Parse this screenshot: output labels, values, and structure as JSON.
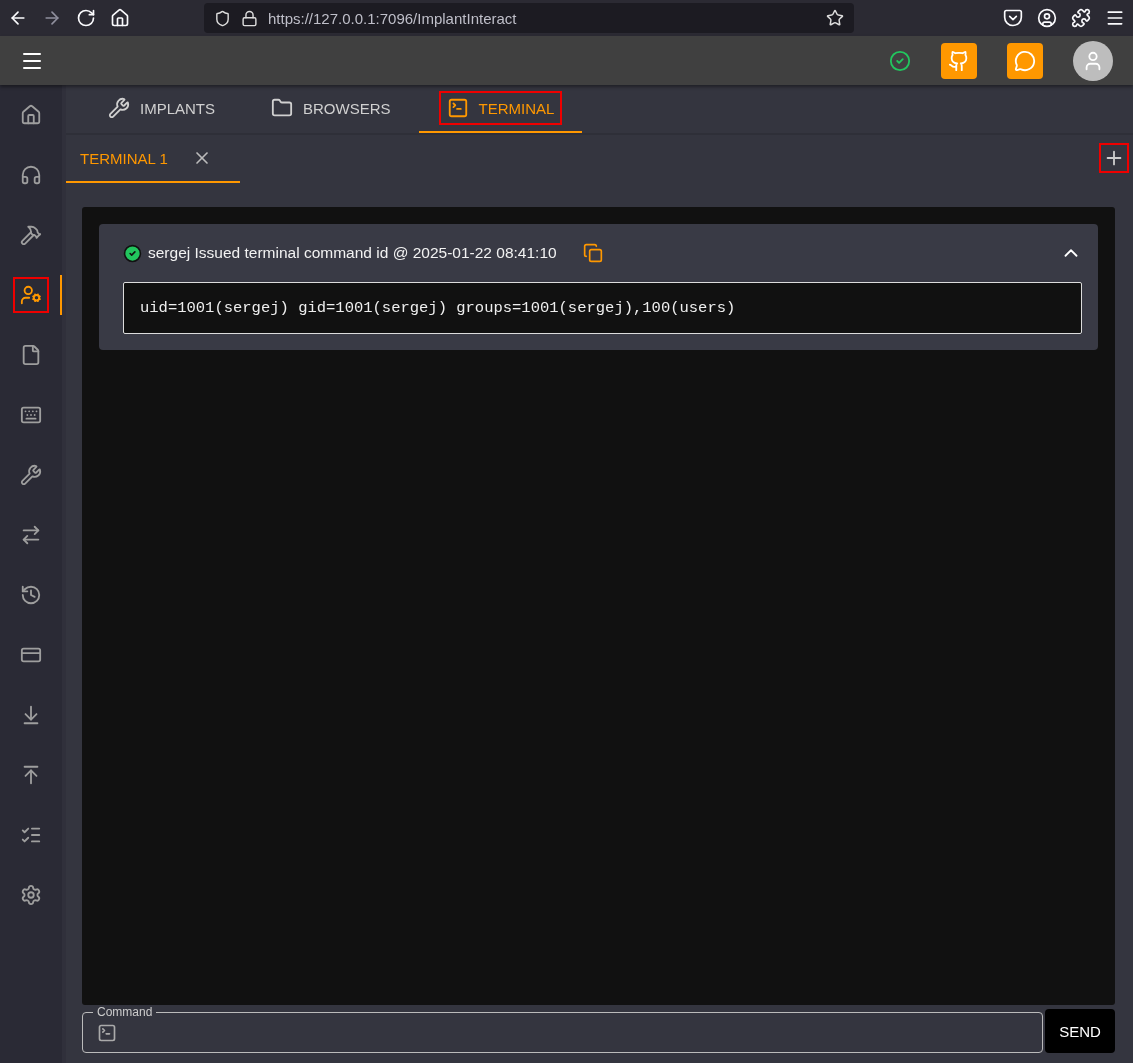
{
  "browser": {
    "url": "https://127.0.0.1:7096/ImplantInteract"
  },
  "sidebar": {
    "items": [
      {
        "selected": false,
        "highlighted": false
      },
      {
        "selected": false,
        "highlighted": false
      },
      {
        "selected": false,
        "highlighted": false
      },
      {
        "selected": true,
        "highlighted": true
      },
      {
        "selected": false,
        "highlighted": false
      },
      {
        "selected": false,
        "highlighted": false
      },
      {
        "selected": false,
        "highlighted": false
      },
      {
        "selected": false,
        "highlighted": false
      },
      {
        "selected": false,
        "highlighted": false
      },
      {
        "selected": false,
        "highlighted": false
      },
      {
        "selected": false,
        "highlighted": false
      },
      {
        "selected": false,
        "highlighted": false
      },
      {
        "selected": false,
        "highlighted": false
      },
      {
        "selected": false,
        "highlighted": false
      }
    ]
  },
  "tabs": [
    {
      "label": "IMPLANTS",
      "selected": false,
      "highlighted": false
    },
    {
      "label": "BROWSERS",
      "selected": false,
      "highlighted": false
    },
    {
      "label": "TERMINAL",
      "selected": true,
      "highlighted": true
    }
  ],
  "terminal_tabs": [
    {
      "label": "TERMINAL 1",
      "selected": true
    }
  ],
  "add_terminal": {
    "highlighted": true
  },
  "entries": [
    {
      "succeeded": true,
      "header": "sergej Issued terminal command id @ 2025-01-22 08:41:10",
      "expanded": true,
      "output": "uid=1001(sergej) gid=1001(sergej) groups=1001(sergej),100(users)"
    }
  ],
  "command": {
    "label": "Command"
  },
  "send_button": "SEND"
}
